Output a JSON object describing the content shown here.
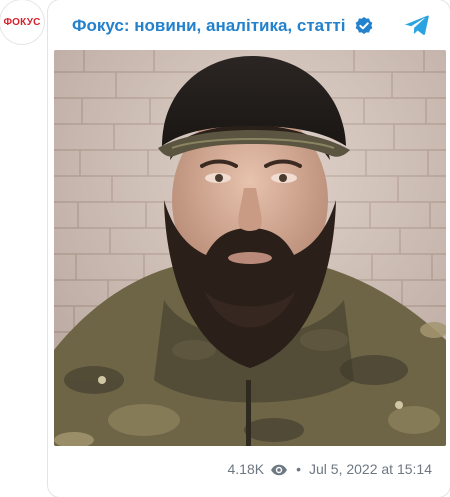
{
  "channel": {
    "avatar_text": "ФОКУС",
    "title": "Фокус: новини, аналітика, статті",
    "verified_icon": "verified-badge-icon",
    "share_icon": "telegram-icon"
  },
  "post": {
    "media_icon": "video-thumbnail",
    "views": "4.18K",
    "views_icon": "eye-icon",
    "separator": "•",
    "date": "Jul 5, 2022 at 15:14"
  },
  "colors": {
    "accent": "#2481cc",
    "brand_red": "#d6202a",
    "meta": "#6d7883"
  }
}
